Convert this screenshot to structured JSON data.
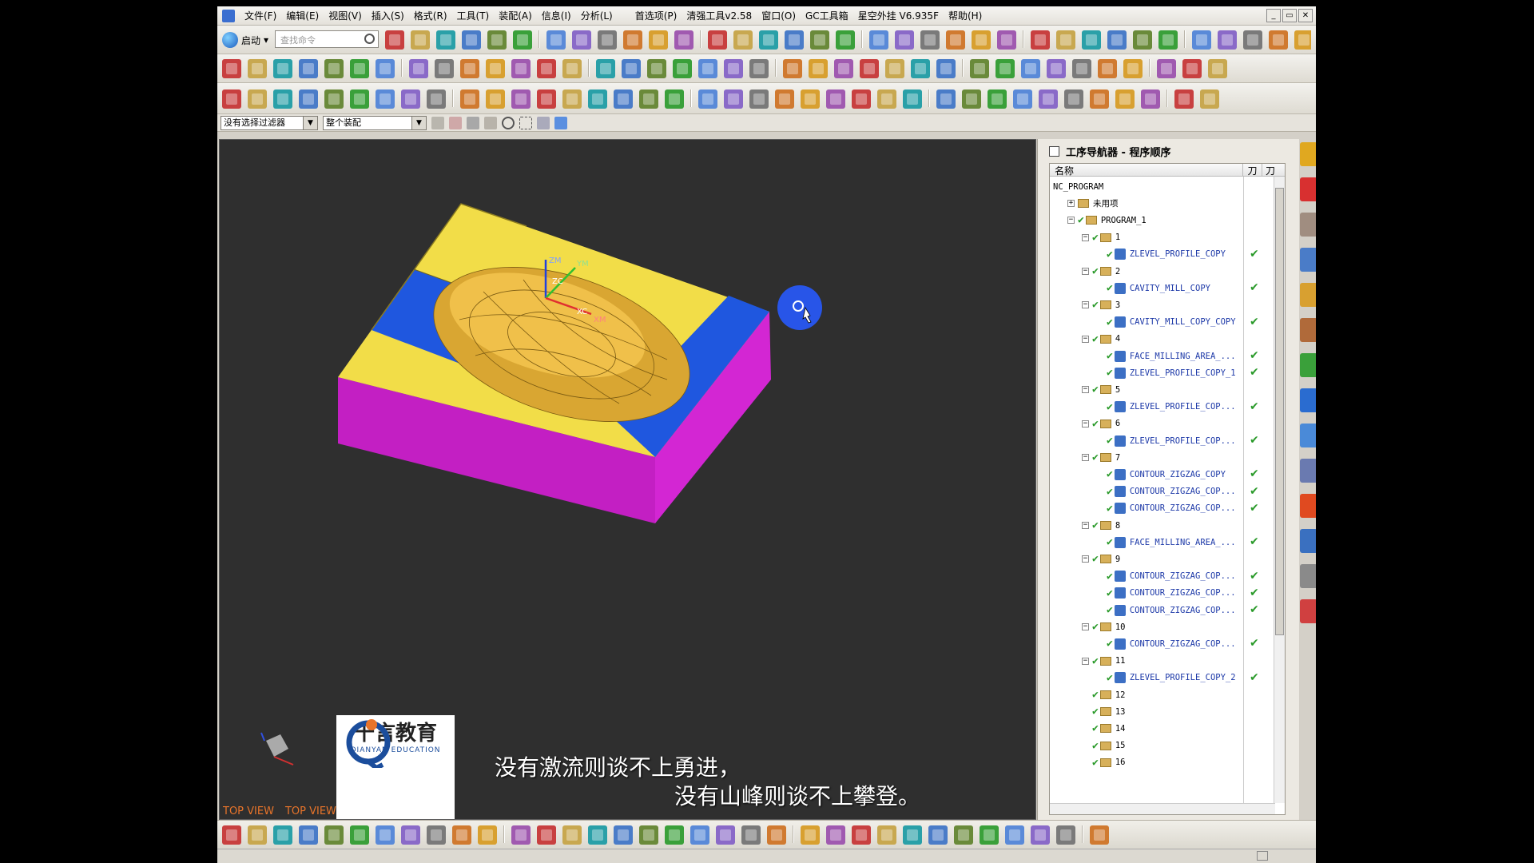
{
  "menu": {
    "items": [
      "文件(F)",
      "编辑(E)",
      "视图(V)",
      "插入(S)",
      "格式(R)",
      "工具(T)",
      "装配(A)",
      "信息(I)",
      "分析(L)",
      "首选项(P)",
      "清强工具v2.58",
      "窗口(O)",
      "GC工具箱",
      "星空外挂 V6.935F",
      "帮助(H)"
    ]
  },
  "toolbar1": {
    "start_label": "启动",
    "search_placeholder": "查找命令"
  },
  "filterbar": {
    "filter_value": "没有选择过滤器",
    "scope_value": "整个装配"
  },
  "viewport": {
    "view_labels": [
      "TOP VIEW",
      "TOP VIEW"
    ],
    "logo_cn": "千言教育",
    "logo_en": "QIANYAN EDUCATION",
    "subtitle_line1": "没有激流则谈不上勇进，",
    "subtitle_line2": "没有山峰则谈不上攀登。",
    "axis_labels": [
      "ZM",
      "YM",
      "ZC",
      "XC",
      "XM"
    ],
    "colors": {
      "top_face": "#f5e04a",
      "side_face": "#c81fc8",
      "blue_face": "#1f58e0",
      "part": "#e6b43a",
      "background": "#2f2f2f"
    }
  },
  "navigator": {
    "title": "工序导航器 - 程序顺序",
    "col_name": "名称",
    "col_tool": "刀",
    "col_path": "刀",
    "rows": [
      {
        "label": "NC_PROGRAM",
        "kind": "root",
        "indent": 0
      },
      {
        "label": "未用项",
        "kind": "group",
        "indent": 1,
        "toggle": "+"
      },
      {
        "label": "PROGRAM_1",
        "kind": "group",
        "indent": 1,
        "toggle": "−",
        "check": true
      },
      {
        "label": "1",
        "kind": "group",
        "indent": 2,
        "toggle": "−",
        "check": true
      },
      {
        "label": "ZLEVEL_PROFILE_COPY",
        "kind": "op",
        "indent": 3,
        "check": true,
        "status": true
      },
      {
        "label": "2",
        "kind": "group",
        "indent": 2,
        "toggle": "−",
        "check": true
      },
      {
        "label": "CAVITY_MILL_COPY",
        "kind": "op",
        "indent": 3,
        "check": true,
        "status": true
      },
      {
        "label": "3",
        "kind": "group",
        "indent": 2,
        "toggle": "−",
        "check": true
      },
      {
        "label": "CAVITY_MILL_COPY_COPY",
        "kind": "op",
        "indent": 3,
        "check": true,
        "status": true
      },
      {
        "label": "4",
        "kind": "group",
        "indent": 2,
        "toggle": "−",
        "check": true
      },
      {
        "label": "FACE_MILLING_AREA_...",
        "kind": "op",
        "indent": 3,
        "check": true,
        "status": true
      },
      {
        "label": "ZLEVEL_PROFILE_COPY_1",
        "kind": "op",
        "indent": 3,
        "check": true,
        "status": true
      },
      {
        "label": "5",
        "kind": "group",
        "indent": 2,
        "toggle": "−",
        "check": true
      },
      {
        "label": "ZLEVEL_PROFILE_COP...",
        "kind": "op",
        "indent": 3,
        "check": true,
        "status": true
      },
      {
        "label": "6",
        "kind": "group",
        "indent": 2,
        "toggle": "−",
        "check": true
      },
      {
        "label": "ZLEVEL_PROFILE_COP...",
        "kind": "op",
        "indent": 3,
        "check": true,
        "status": true
      },
      {
        "label": "7",
        "kind": "group",
        "indent": 2,
        "toggle": "−",
        "check": true
      },
      {
        "label": "CONTOUR_ZIGZAG_COPY",
        "kind": "op",
        "indent": 3,
        "check": true,
        "status": true
      },
      {
        "label": "CONTOUR_ZIGZAG_COP...",
        "kind": "op",
        "indent": 3,
        "check": true,
        "status": true
      },
      {
        "label": "CONTOUR_ZIGZAG_COP...",
        "kind": "op",
        "indent": 3,
        "check": true,
        "status": true
      },
      {
        "label": "8",
        "kind": "group",
        "indent": 2,
        "toggle": "−",
        "check": true
      },
      {
        "label": "FACE_MILLING_AREA_...",
        "kind": "op",
        "indent": 3,
        "check": true,
        "status": true
      },
      {
        "label": "9",
        "kind": "group",
        "indent": 2,
        "toggle": "−",
        "check": true
      },
      {
        "label": "CONTOUR_ZIGZAG_COP...",
        "kind": "op",
        "indent": 3,
        "check": true,
        "status": true
      },
      {
        "label": "CONTOUR_ZIGZAG_COP...",
        "kind": "op",
        "indent": 3,
        "check": true,
        "status": true
      },
      {
        "label": "CONTOUR_ZIGZAG_COP...",
        "kind": "op",
        "indent": 3,
        "check": true,
        "status": true
      },
      {
        "label": "10",
        "kind": "group",
        "indent": 2,
        "toggle": "−",
        "check": true
      },
      {
        "label": "CONTOUR_ZIGZAG_COP...",
        "kind": "op",
        "indent": 3,
        "check": true,
        "status": true
      },
      {
        "label": "11",
        "kind": "group",
        "indent": 2,
        "toggle": "−",
        "check": true
      },
      {
        "label": "ZLEVEL_PROFILE_COPY_2",
        "kind": "op",
        "indent": 3,
        "check": true,
        "status": true
      },
      {
        "label": "12",
        "kind": "group",
        "indent": 2,
        "check": true
      },
      {
        "label": "13",
        "kind": "group",
        "indent": 2,
        "check": true
      },
      {
        "label": "14",
        "kind": "group",
        "indent": 2,
        "check": true
      },
      {
        "label": "15",
        "kind": "group",
        "indent": 2,
        "check": true
      },
      {
        "label": "16",
        "kind": "group",
        "indent": 2,
        "check": true
      }
    ]
  }
}
